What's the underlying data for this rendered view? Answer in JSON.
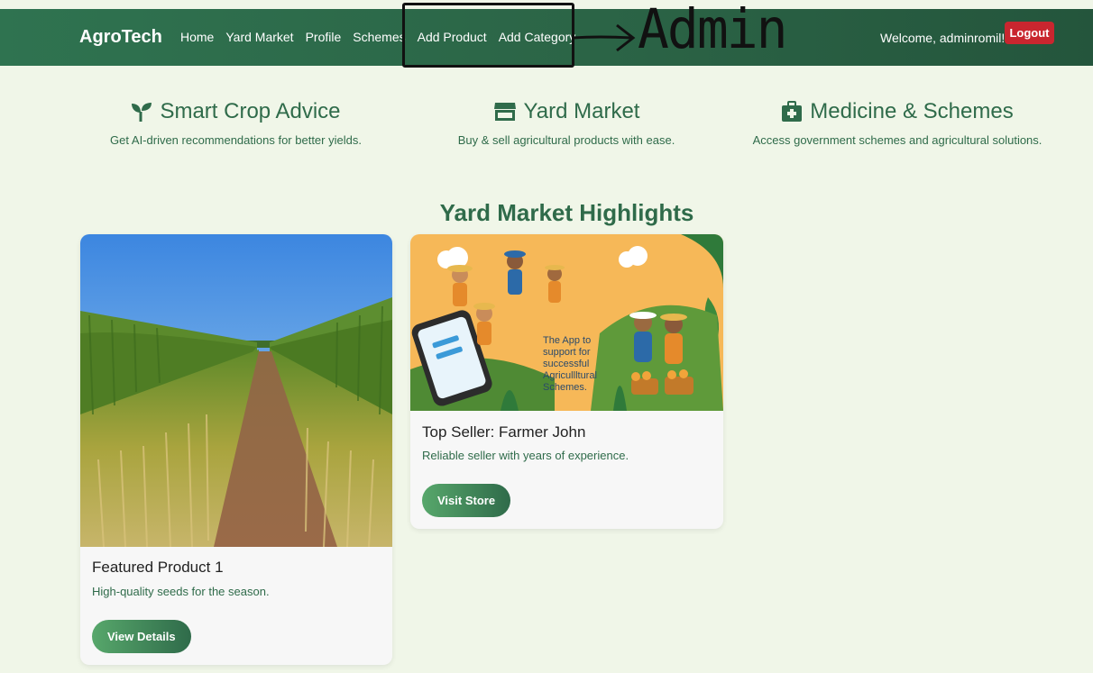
{
  "nav": {
    "brand": "AgroTech",
    "links": [
      "Home",
      "Yard Market",
      "Profile",
      "Schemes",
      "Add Product",
      "Add Category"
    ],
    "welcome": "Welcome, adminromil!",
    "logout": "Logout"
  },
  "annotation": {
    "text": "Admin"
  },
  "features": [
    {
      "icon": "seedling-icon",
      "title": "Smart Crop Advice",
      "desc": "Get AI-driven recommendations for better yields."
    },
    {
      "icon": "store-icon",
      "title": "Yard Market",
      "desc": "Buy & sell agricultural products with ease."
    },
    {
      "icon": "medkit-icon",
      "title": "Medicine & Schemes",
      "desc": "Access government schemes and agricultural solutions."
    }
  ],
  "highlights": {
    "title": "Yard Market Highlights",
    "cards": [
      {
        "title": "Featured Product 1",
        "desc": "High-quality seeds for the season.",
        "button": "View Details"
      },
      {
        "title": "Top Seller: Farmer John",
        "desc": "Reliable seller with years of experience.",
        "button": "Visit Store",
        "image_caption": "The App to support for successful Agricultural Schemes."
      }
    ]
  },
  "colors": {
    "nav": "#2b6446",
    "accent_green": "#2f6b4a",
    "logout": "#c9262f",
    "background": "#f0f6e8"
  }
}
